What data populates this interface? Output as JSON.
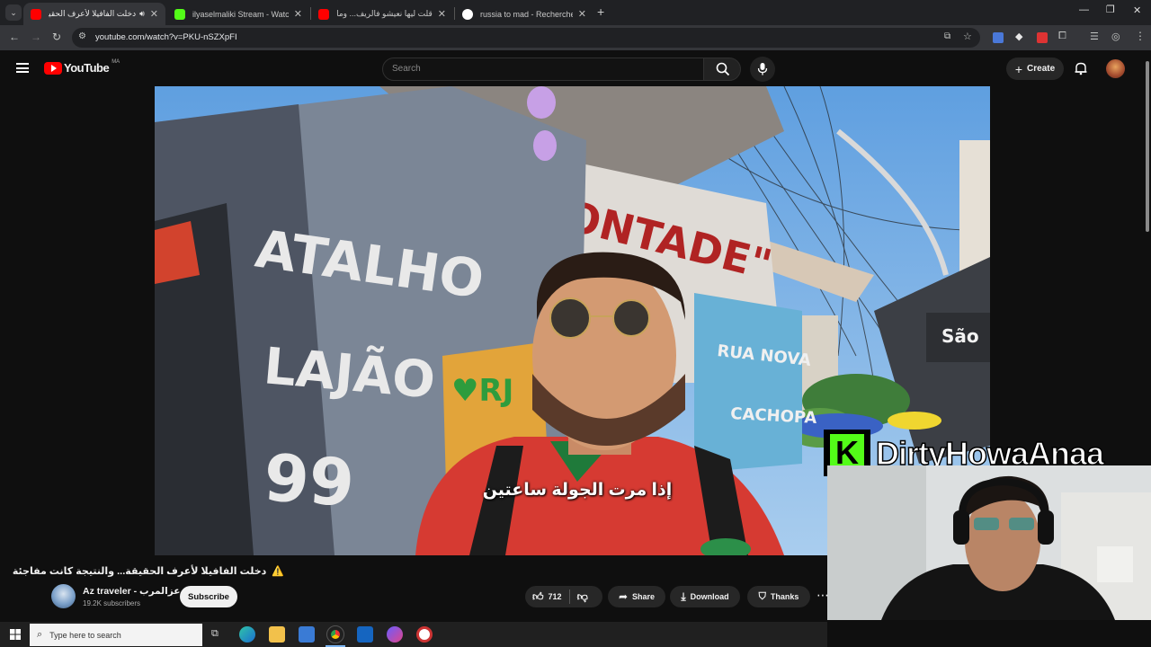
{
  "browser": {
    "tabs": [
      {
        "title": "دخلت الفافيلا لأعرف الحقيقة...",
        "active": true,
        "favicon": "youtube-icon"
      },
      {
        "title": "ilyaselmaliki Stream - Watch Liv",
        "active": false,
        "favicon": "kick-icon"
      },
      {
        "title": "قلت ليها نعيشو فالريف... وما كنت",
        "active": false,
        "favicon": "youtube-icon"
      },
      {
        "title": "russia to mad - Recherche Goo",
        "active": false,
        "favicon": "google-icon"
      }
    ],
    "url": "youtube.com/watch?v=PKU-nSZXpFI"
  },
  "youtube": {
    "logo_text": "YouTube",
    "country": "MA",
    "search_placeholder": "Search",
    "create_label": "Create"
  },
  "video": {
    "subtitle": "إذا مرت الجولة ساعتين",
    "graffiti": [
      "ATALHO",
      "LAJÃO",
      "99",
      "RUA NOVA",
      "CACHOPA",
      "São"
    ],
    "overlay_name": "DirtyHowaAnaa",
    "overlay_badge": "K"
  },
  "meta": {
    "title": "دخلت الفافيلا لأعرف الحقيقة... والنتيجة كانت مفاجئة",
    "warning": "⚠️",
    "channel_name": "Az traveler - عزالمرب",
    "subscribers": "19.2K subscribers",
    "subscribe_label": "Subscribe",
    "likes": "712",
    "share_label": "Share",
    "download_label": "Download",
    "thanks_label": "Thanks",
    "more_label": "⋯"
  },
  "taskbar": {
    "search_placeholder": "Type here to search"
  },
  "colors": {
    "youtube_red": "#ff0000",
    "kick_green": "#53fc18",
    "chrome_dark": "#202124",
    "toolbar": "#35363a"
  }
}
